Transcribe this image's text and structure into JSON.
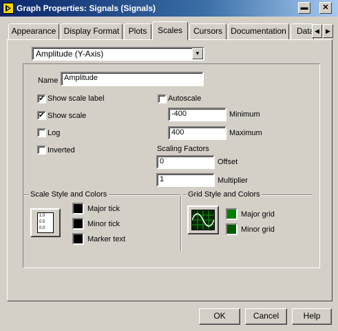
{
  "window": {
    "title": "Graph Properties: Signals (Signals)",
    "buttons": {
      "minimize": "▬",
      "close": "✕"
    }
  },
  "tabs": [
    "Appearance",
    "Display Format",
    "Plots",
    "Scales",
    "Cursors",
    "Documentation",
    "Data"
  ],
  "active_tab": "Scales",
  "tab_scroll": {
    "left": "◀",
    "right": "▶"
  },
  "scale_selector": {
    "value": "Amplitude (Y-Axis)",
    "arrow": "▼"
  },
  "name": {
    "label": "Name",
    "value": "Amplitude"
  },
  "checkboxes": {
    "show_scale_label": {
      "label": "Show scale label",
      "checked": true
    },
    "show_scale": {
      "label": "Show scale",
      "checked": true
    },
    "log": {
      "label": "Log",
      "checked": false
    },
    "inverted": {
      "label": "Inverted",
      "checked": false
    },
    "autoscale": {
      "label": "Autoscale",
      "checked": false
    }
  },
  "check_mark": "✔",
  "minimum": {
    "label": "Minimum",
    "value": "-400"
  },
  "maximum": {
    "label": "Maximum",
    "value": "400"
  },
  "scaling_factors": {
    "title": "Scaling Factors",
    "offset": {
      "label": "Offset",
      "value": "0"
    },
    "multiplier": {
      "label": "Multiplier",
      "value": "1"
    }
  },
  "scale_style": {
    "title": "Scale Style and Colors",
    "icon_ticks": [
      "1.0",
      "0.5",
      "0.0"
    ],
    "items": [
      {
        "label": "Major tick",
        "color": "#000000"
      },
      {
        "label": "Minor tick",
        "color": "#000000"
      },
      {
        "label": "Marker text",
        "color": "#000000"
      }
    ]
  },
  "grid_style": {
    "title": "Grid Style and Colors",
    "items": [
      {
        "label": "Major grid",
        "color": "#008000"
      },
      {
        "label": "Minor grid",
        "color": "#005a00"
      }
    ]
  },
  "dialog_buttons": {
    "ok": "OK",
    "cancel": "Cancel",
    "help": "Help"
  }
}
